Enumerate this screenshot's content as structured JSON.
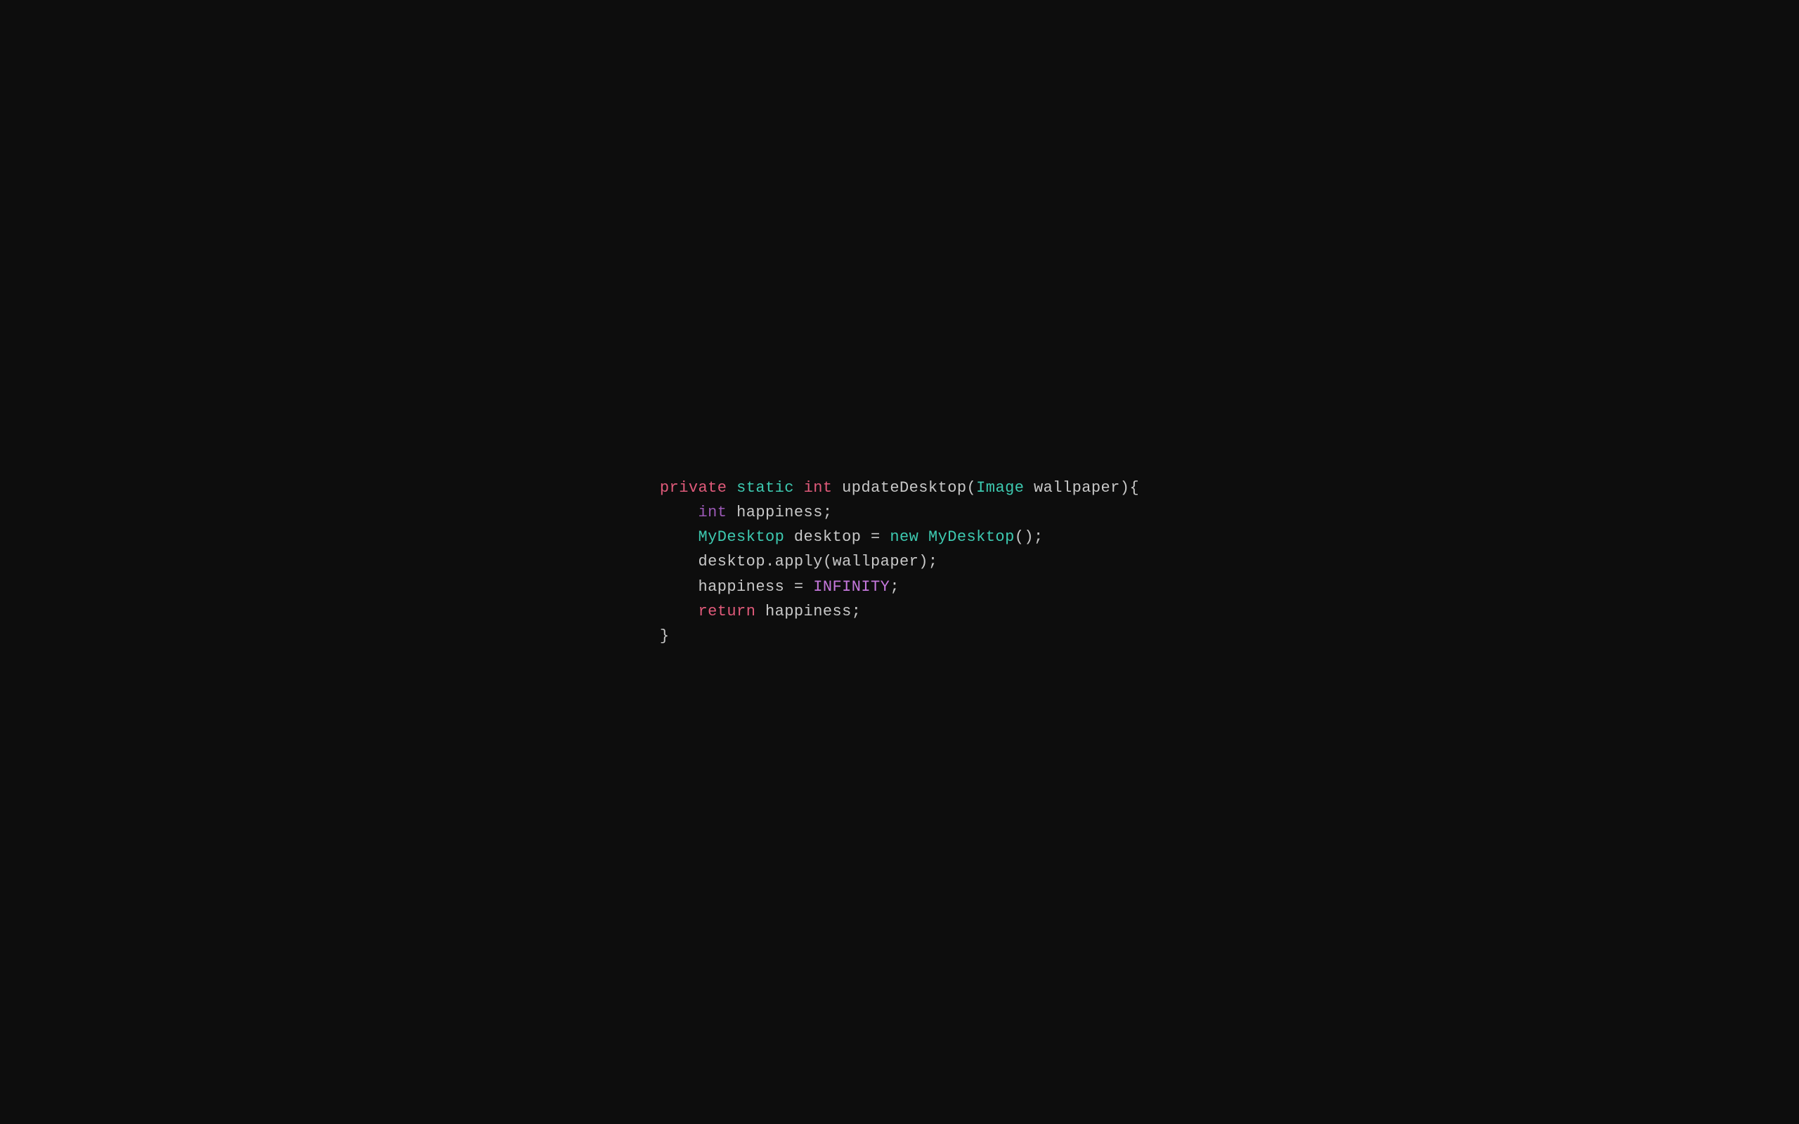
{
  "code": {
    "lines": [
      {
        "id": "line1",
        "parts": [
          {
            "text": "private",
            "class": "kw-private"
          },
          {
            "text": " ",
            "class": "plain"
          },
          {
            "text": "static",
            "class": "kw-static"
          },
          {
            "text": " ",
            "class": "plain"
          },
          {
            "text": "int",
            "class": "kw-int"
          },
          {
            "text": " updateDesktop(",
            "class": "plain"
          },
          {
            "text": "Image",
            "class": "type-image"
          },
          {
            "text": " wallpaper){",
            "class": "plain"
          }
        ]
      },
      {
        "id": "line2",
        "parts": [
          {
            "text": "    ",
            "class": "plain"
          },
          {
            "text": "int",
            "class": "kw-int2"
          },
          {
            "text": " happiness;",
            "class": "plain"
          }
        ]
      },
      {
        "id": "line3",
        "parts": [
          {
            "text": "    ",
            "class": "plain"
          },
          {
            "text": "MyDesktop",
            "class": "type-mydesk"
          },
          {
            "text": " desktop = ",
            "class": "plain"
          },
          {
            "text": "new",
            "class": "kw-new"
          },
          {
            "text": " ",
            "class": "plain"
          },
          {
            "text": "MyDesktop",
            "class": "type-mydesk"
          },
          {
            "text": "();",
            "class": "plain"
          }
        ]
      },
      {
        "id": "line4",
        "parts": [
          {
            "text": "    desktop.apply(wallpaper);",
            "class": "plain"
          }
        ]
      },
      {
        "id": "line5",
        "parts": [
          {
            "text": "    happiness = ",
            "class": "plain"
          },
          {
            "text": "INFINITY",
            "class": "const-inf"
          },
          {
            "text": ";",
            "class": "plain"
          }
        ]
      },
      {
        "id": "line6",
        "parts": [
          {
            "text": "    ",
            "class": "plain"
          },
          {
            "text": "return",
            "class": "kw-return"
          },
          {
            "text": " happiness;",
            "class": "plain"
          }
        ]
      },
      {
        "id": "line7",
        "parts": [
          {
            "text": "}",
            "class": "plain"
          }
        ]
      }
    ]
  }
}
